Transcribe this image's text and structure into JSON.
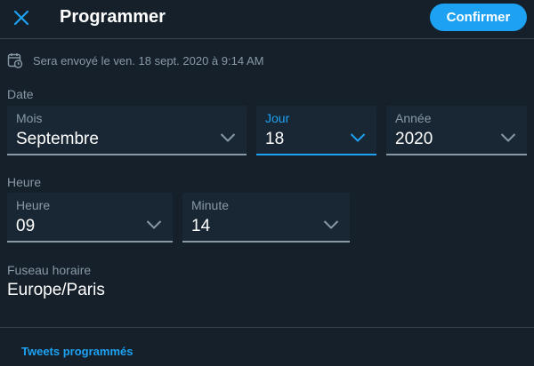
{
  "header": {
    "title": "Programmer",
    "confirm_label": "Confirmer"
  },
  "scheduled": {
    "text": "Sera envoyé le ven. 18 sept. 2020 à 9:14 AM"
  },
  "date": {
    "section_label": "Date",
    "month": {
      "label": "Mois",
      "value": "Septembre"
    },
    "day": {
      "label": "Jour",
      "value": "18"
    },
    "year": {
      "label": "Année",
      "value": "2020"
    }
  },
  "time": {
    "section_label": "Heure",
    "hour": {
      "label": "Heure",
      "value": "09"
    },
    "minute": {
      "label": "Minute",
      "value": "14"
    }
  },
  "timezone": {
    "label": "Fuseau horaire",
    "value": "Europe/Paris"
  },
  "footer": {
    "link_label": "Tweets programmés"
  },
  "colors": {
    "background": "#15202b",
    "accent": "#1da1f2",
    "field_background": "#192734",
    "muted_text": "#8899a6",
    "divider": "#38444d"
  }
}
